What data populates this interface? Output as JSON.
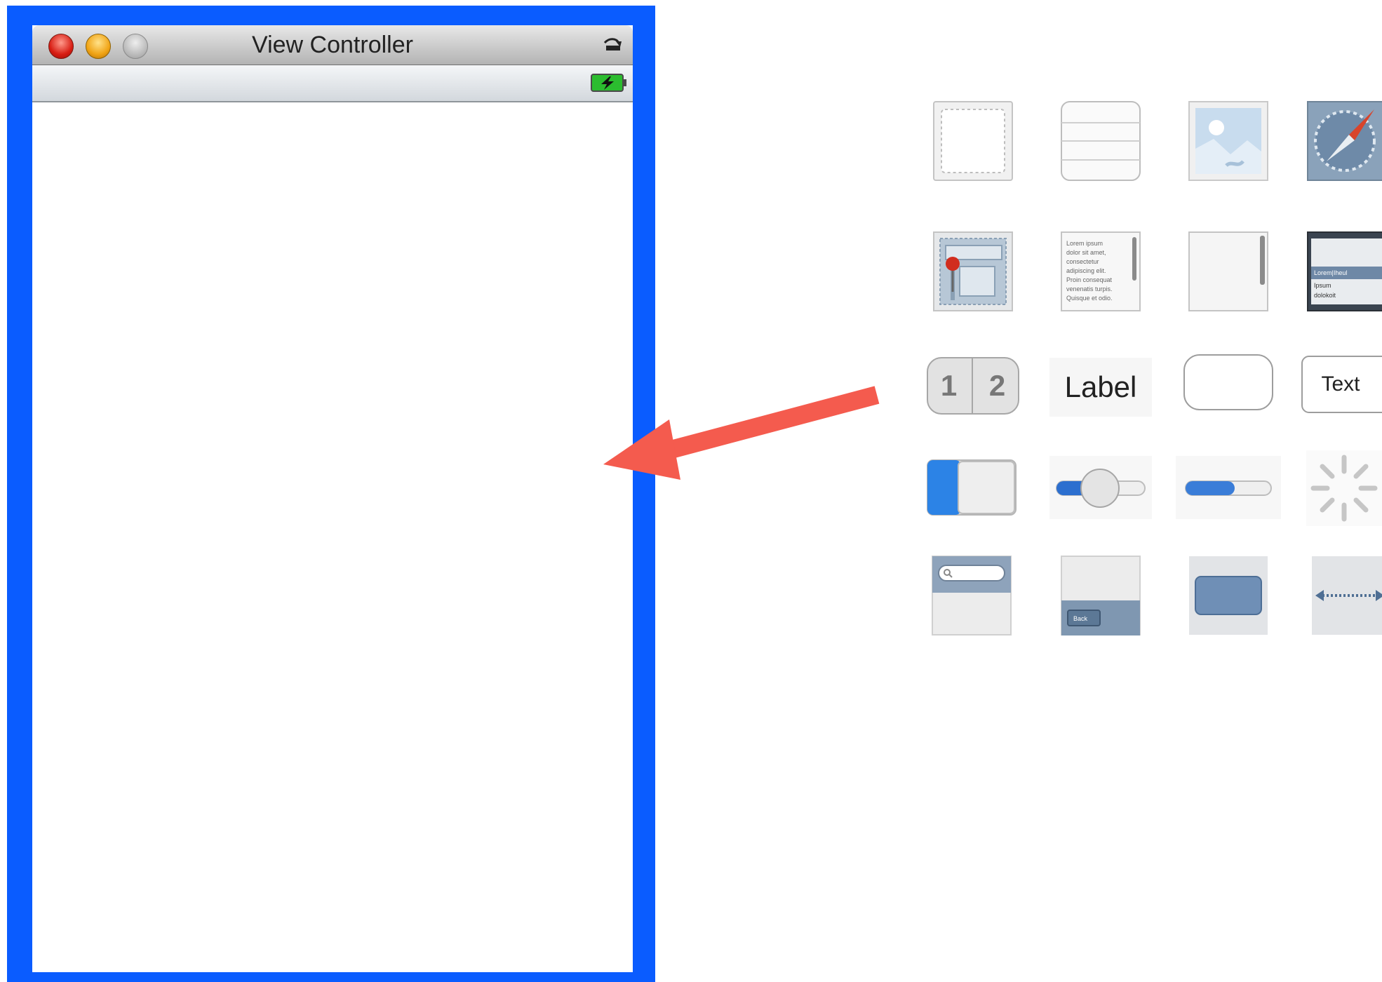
{
  "window": {
    "title": "View Controller",
    "icons": [
      "close-button",
      "minimize-button",
      "zoom-button",
      "rotate-icon",
      "battery-charging-icon"
    ]
  },
  "annotation": {
    "arrow_color": "#f45b4e",
    "frame_color": "#0a5cff"
  },
  "library": {
    "label_object": "Label",
    "text_field": "Text",
    "segmented": [
      "1",
      "2"
    ],
    "text_view_lorem": [
      "Lorem ipsum",
      "dolor sit amet,",
      "consectetur",
      "adipiscing elit.",
      "Proin consequat",
      "venenatis turpis.",
      "Quisque et odio."
    ],
    "picker_rows": [
      "Lorem|Iheul",
      "Ipsum",
      "dolokoit"
    ],
    "back_button": "Back"
  }
}
